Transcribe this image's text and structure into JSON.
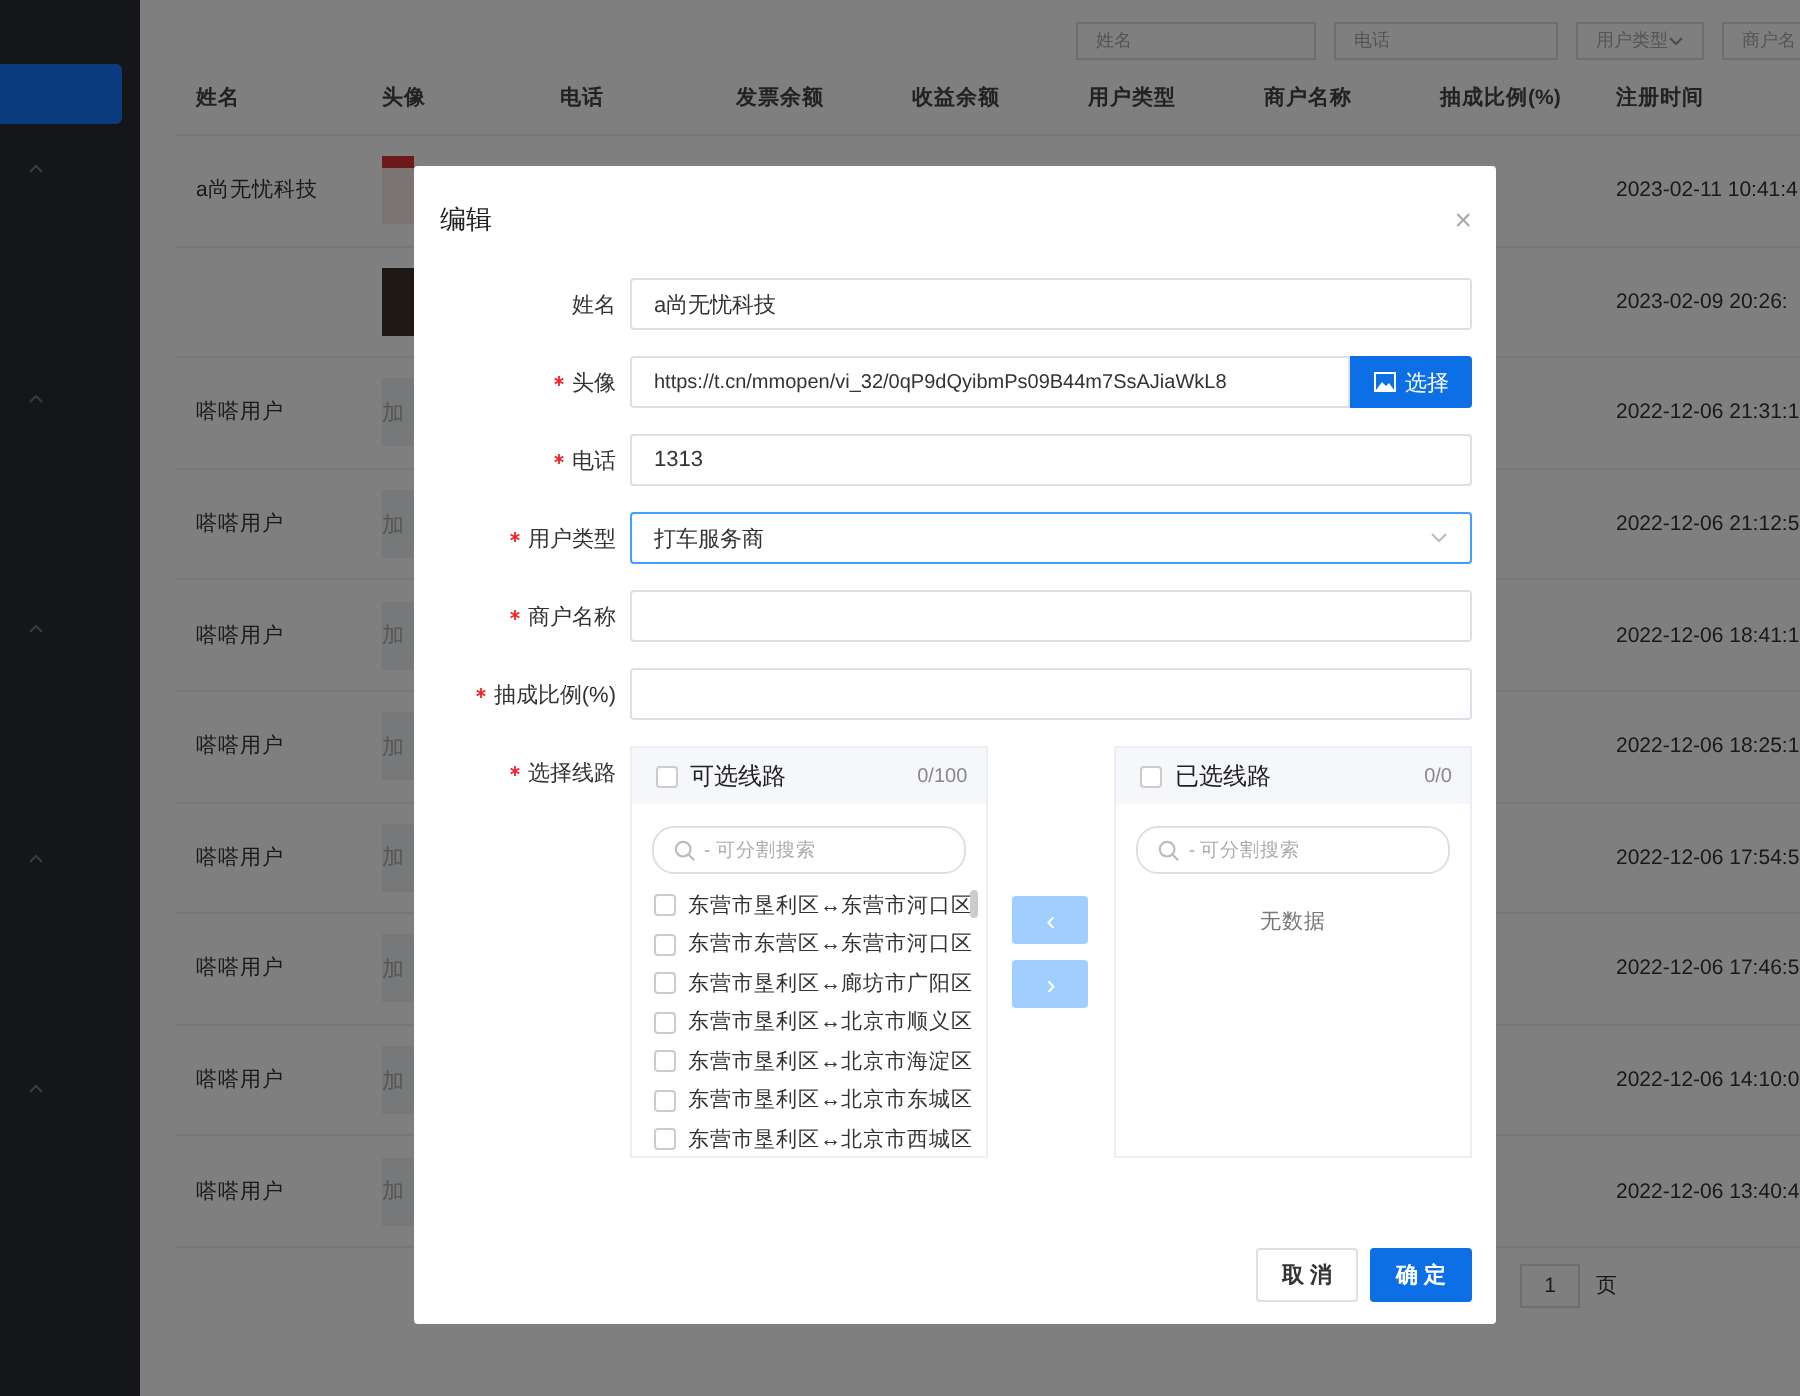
{
  "sidebar": {
    "active_item": {
      "selected": true
    },
    "groups": [
      {
        "expanded": false
      },
      {
        "expanded": false
      },
      {
        "expanded": false
      },
      {
        "expanded": false
      },
      {
        "expanded": false
      }
    ]
  },
  "filters": [
    {
      "kind": "input",
      "placeholder": "姓名"
    },
    {
      "kind": "input",
      "placeholder": "电话"
    },
    {
      "kind": "select",
      "placeholder": "用户类型"
    },
    {
      "kind": "input",
      "placeholder": "商户名"
    }
  ],
  "table": {
    "columns": [
      "姓名",
      "头像",
      "电话",
      "发票余额",
      "收益余额",
      "用户类型",
      "商户名称",
      "抽成比例(%)",
      "注册时间"
    ],
    "rows": [
      {
        "name": "a尚无忧科技",
        "avatar": {
          "kind": "logo"
        },
        "registered": "2023-02-11 10:41:4"
      },
      {
        "avatar": {
          "kind": "photo"
        },
        "registered": "2023-02-09 20:26:"
      },
      {
        "name": "嗒嗒用户",
        "avatar": {
          "kind": "loading",
          "text": "加"
        },
        "registered": "2022-12-06 21:31:1"
      },
      {
        "name": "嗒嗒用户",
        "avatar": {
          "kind": "loading",
          "text": "加"
        },
        "registered": "2022-12-06 21:12:5"
      },
      {
        "name": "嗒嗒用户",
        "avatar": {
          "kind": "loading",
          "text": "加"
        },
        "registered": "2022-12-06 18:41:1"
      },
      {
        "name": "嗒嗒用户",
        "avatar": {
          "kind": "loading",
          "text": "加"
        },
        "registered": "2022-12-06 18:25:1"
      },
      {
        "name": "嗒嗒用户",
        "avatar": {
          "kind": "loading",
          "text": "加"
        },
        "registered": "2022-12-06 17:54:5"
      },
      {
        "name": "嗒嗒用户",
        "avatar": {
          "kind": "loading",
          "text": "加"
        },
        "registered": "2022-12-06 17:46:5"
      },
      {
        "name": "嗒嗒用户",
        "avatar": {
          "kind": "loading",
          "text": "加"
        },
        "registered": "2022-12-06 14:10:0"
      },
      {
        "name": "嗒嗒用户",
        "avatar": {
          "kind": "loading",
          "text": "加"
        },
        "registered": "2022-12-06 13:40:4"
      }
    ]
  },
  "pagination": {
    "page": "1",
    "suffix": "页"
  },
  "dialog": {
    "title": "编辑",
    "close": "×",
    "fields": [
      {
        "kind": "input",
        "label": "姓名",
        "required": false,
        "value": "a尚无忧科技"
      },
      {
        "kind": "upload",
        "label": "头像",
        "required": true,
        "value": "https://t.cn/mmopen/vi_32/0qP9dQyibmPs09B44m7SsAJiaWkL8",
        "button": "选择"
      },
      {
        "kind": "input",
        "label": "电话",
        "required": true,
        "value": "1313"
      },
      {
        "kind": "select",
        "label": "用户类型",
        "required": true,
        "value": "打车服务商",
        "focused": true
      },
      {
        "kind": "input",
        "label": "商户名称",
        "required": true
      },
      {
        "kind": "input",
        "label": "抽成比例(%)",
        "required": true
      }
    ],
    "transfer": {
      "label": "选择线路",
      "required": true,
      "left": {
        "title": "可选线路",
        "count": "0/100",
        "checked": false,
        "placeholder": "- 可分割搜索",
        "items": [
          {
            "label": "东营市垦利区↔东营市河口区",
            "checked": false
          },
          {
            "label": "东营市东营区↔东营市河口区",
            "checked": false
          },
          {
            "label": "东营市垦利区↔廊坊市广阳区",
            "checked": false
          },
          {
            "label": "东营市垦利区↔北京市顺义区",
            "checked": false
          },
          {
            "label": "东营市垦利区↔北京市海淀区",
            "checked": false
          },
          {
            "label": "东营市垦利区↔北京市东城区",
            "checked": false
          },
          {
            "label": "东营市垦利区↔北京市西城区",
            "checked": false
          }
        ]
      },
      "buttons": [
        {
          "label": "‹",
          "disabled": true
        },
        {
          "label": "›",
          "disabled": true
        }
      ],
      "right": {
        "title": "已选线路",
        "count": "0/0",
        "checked": false,
        "placeholder": "- 可分割搜索",
        "empty": "无数据"
      }
    },
    "buttons": [
      {
        "kind": "default",
        "label": "取 消"
      },
      {
        "kind": "primary",
        "label": "确 定"
      }
    ]
  }
}
